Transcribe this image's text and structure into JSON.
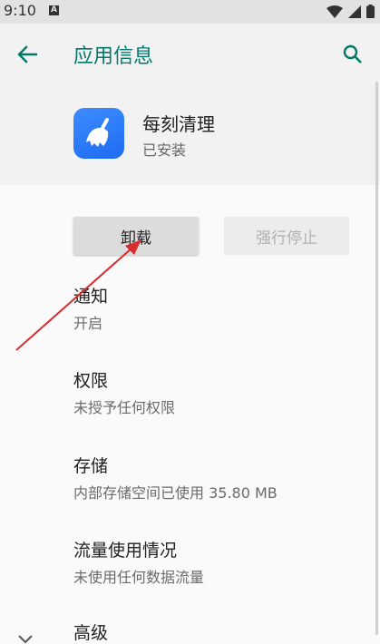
{
  "status_bar": {
    "time": "9:10",
    "notification_letter": "A"
  },
  "header": {
    "title": "应用信息",
    "back_icon": "arrow-left-icon",
    "search_icon": "search-icon"
  },
  "app": {
    "name": "每刻清理",
    "status": "已安装",
    "icon": "broom-icon",
    "icon_color": "#2f7bf5"
  },
  "buttons": {
    "uninstall": "卸载",
    "force_stop": "强行停止"
  },
  "items": [
    {
      "title": "通知",
      "subtitle": "开启"
    },
    {
      "title": "权限",
      "subtitle": "未授予任何权限"
    },
    {
      "title": "存储",
      "subtitle": "内部存储空间已使用 35.80 MB"
    },
    {
      "title": "流量使用情况",
      "subtitle": "未使用任何数据流量"
    },
    {
      "title": "高级",
      "subtitle": ""
    }
  ],
  "colors": {
    "accent": "#00796b",
    "annotation_arrow": "#d32f2f"
  }
}
